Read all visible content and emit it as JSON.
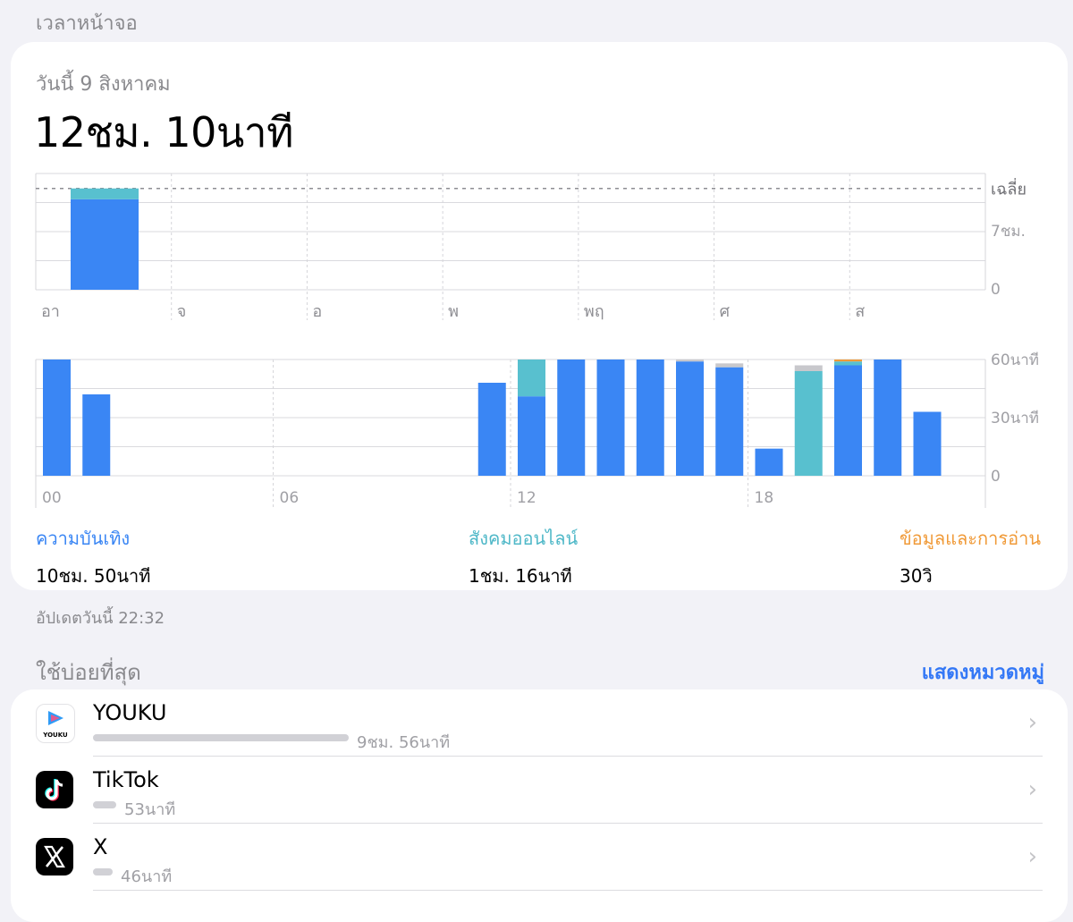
{
  "section_title": "เวลาหน้าจอ",
  "date_label": "วันนี้ 9 สิงหาคม",
  "total_time": "12ชม. 10นาที",
  "colors": {
    "entertainment": "#3a86f4",
    "social": "#58c0cf",
    "reading": "#f09a38",
    "other": "#c8c8cc",
    "accent": "#3478f6"
  },
  "weekly_chart": {
    "type": "bar",
    "avg_label": "เฉลี่ย",
    "days": [
      "อา",
      "จ",
      "อ",
      "พ",
      "พฤ",
      "ศ",
      "ส"
    ],
    "y_ticks": [
      {
        "value": 7,
        "label": "7ชม."
      },
      {
        "value": 0,
        "label": "0"
      }
    ],
    "ylim": [
      0,
      14
    ],
    "average_hours": 12.2,
    "series": [
      {
        "name": "ความบันเทิง",
        "color": "#3a86f4",
        "values": [
          10.9,
          0,
          0,
          0,
          0,
          0,
          0
        ]
      },
      {
        "name": "สังคมออนไลน์",
        "color": "#58c0cf",
        "values": [
          1.3,
          0,
          0,
          0,
          0,
          0,
          0
        ]
      }
    ]
  },
  "hourly_chart": {
    "type": "bar",
    "x_tick_labels": [
      {
        "hour": 0,
        "label": "00"
      },
      {
        "hour": 6,
        "label": "06"
      },
      {
        "hour": 12,
        "label": "12"
      },
      {
        "hour": 18,
        "label": "18"
      }
    ],
    "y_ticks": [
      {
        "value": 60,
        "label": "60นาที"
      },
      {
        "value": 30,
        "label": "30นาที"
      },
      {
        "value": 0,
        "label": "0"
      }
    ],
    "ylim": [
      0,
      60
    ],
    "hours": [
      {
        "hour": 0,
        "entertainment": 60,
        "social": 0,
        "reading": 0,
        "other": 0
      },
      {
        "hour": 1,
        "entertainment": 42,
        "social": 0,
        "reading": 0,
        "other": 0
      },
      {
        "hour": 11,
        "entertainment": 48,
        "social": 0,
        "reading": 0,
        "other": 0
      },
      {
        "hour": 12,
        "entertainment": 41,
        "social": 19,
        "reading": 0,
        "other": 0
      },
      {
        "hour": 13,
        "entertainment": 60,
        "social": 0,
        "reading": 0,
        "other": 0
      },
      {
        "hour": 14,
        "entertainment": 60,
        "social": 0,
        "reading": 0,
        "other": 0
      },
      {
        "hour": 15,
        "entertainment": 60,
        "social": 0,
        "reading": 0,
        "other": 0
      },
      {
        "hour": 16,
        "entertainment": 59,
        "social": 0,
        "reading": 0,
        "other": 1
      },
      {
        "hour": 17,
        "entertainment": 56,
        "social": 0,
        "reading": 0,
        "other": 2
      },
      {
        "hour": 18,
        "entertainment": 14,
        "social": 0,
        "reading": 0,
        "other": 0
      },
      {
        "hour": 19,
        "entertainment": 0,
        "social": 54,
        "reading": 0,
        "other": 3
      },
      {
        "hour": 20,
        "entertainment": 57,
        "social": 2,
        "reading": 1,
        "other": 0
      },
      {
        "hour": 21,
        "entertainment": 60,
        "social": 0,
        "reading": 0,
        "other": 0
      },
      {
        "hour": 22,
        "entertainment": 33,
        "social": 0,
        "reading": 0,
        "other": 0
      }
    ]
  },
  "categories": [
    {
      "name": "ความบันเทิง",
      "value": "10ชม. 50นาที",
      "color": "#3a86f4"
    },
    {
      "name": "สังคมออนไลน์",
      "value": "1ชม. 16นาที",
      "color": "#58c0cf"
    },
    {
      "name": "ข้อมูลและการอ่าน",
      "value": "30วิ",
      "color": "#f09a38"
    }
  ],
  "updated_label": "อัปเดตวันนี้ 22:32",
  "most_used_title": "ใช้บ่อยที่สุด",
  "show_categories_label": "แสดงหมวดหมู่",
  "apps": [
    {
      "name": "YOUKU",
      "duration": "9ชม. 56นาที",
      "minutes": 596,
      "icon": "youku-icon",
      "icon_text": "YOUKU"
    },
    {
      "name": "TikTok",
      "duration": "53นาที",
      "minutes": 53,
      "icon": "tiktok-icon"
    },
    {
      "name": "X",
      "duration": "46นาที",
      "minutes": 46,
      "icon": "x-icon"
    }
  ]
}
